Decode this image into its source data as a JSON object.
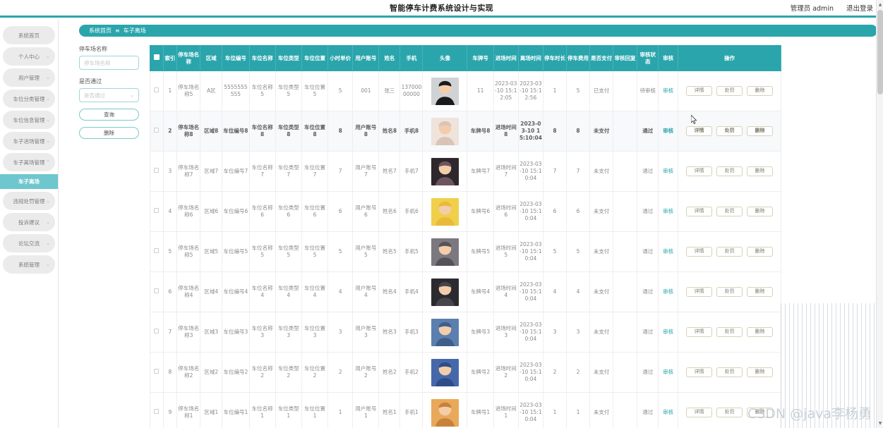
{
  "header": {
    "title": "智能停车计费系统设计与实现",
    "admin_label": "管理员 admin",
    "logout_label": "退出登录"
  },
  "sidebar": {
    "items": [
      {
        "label": "系统首页",
        "caret": "",
        "active": false
      },
      {
        "label": "个人中心",
        "caret": "⌄",
        "active": false
      },
      {
        "label": "用户管理",
        "caret": "⌄",
        "active": false
      },
      {
        "label": "车位分类管理",
        "caret": "⌄",
        "active": false
      },
      {
        "label": "车位信息管理",
        "caret": "⌄",
        "active": false
      },
      {
        "label": "车子进场管理",
        "caret": "⌄",
        "active": false
      },
      {
        "label": "车子离场管理",
        "caret": "⌃",
        "active": false
      },
      {
        "label": "车子离场",
        "caret": "",
        "active": true
      },
      {
        "label": "违规处罚管理",
        "caret": "⌄",
        "active": false
      },
      {
        "label": "投诉建议",
        "caret": "⌄",
        "active": false
      },
      {
        "label": "论坛交流",
        "caret": "⌄",
        "active": false
      },
      {
        "label": "系统管理",
        "caret": "⌄",
        "active": false
      }
    ]
  },
  "breadcrumb": {
    "home": "系统首页",
    "separator": "≡",
    "current": "车子离场"
  },
  "search": {
    "name_label": "停车场名称",
    "name_placeholder": "停车场名称",
    "name_value": "",
    "pass_label": "是否通过",
    "pass_placeholder": "是否通过",
    "pass_value": "",
    "chevron": "⌄",
    "query_button": "查询",
    "delete_button": "删除"
  },
  "table": {
    "headers": [
      "",
      "索引",
      "停车场名称",
      "区域",
      "车位编号",
      "车位名称",
      "车位类型",
      "车位位置",
      "小时单价",
      "用户账号",
      "姓名",
      "手机",
      "头像",
      "车牌号",
      "进场时间",
      "离场时间",
      "停车时长",
      "停车费用",
      "是否支付",
      "审核回复",
      "审核状态",
      "审核",
      "操作"
    ],
    "audit_link": "审核",
    "actions": [
      "详情",
      "处罚",
      "删除"
    ],
    "rows": [
      {
        "index": "1",
        "lot": "停车场名称5",
        "area": "A区",
        "spot_no": "5555555555",
        "spot_name": "车位名称5",
        "spot_type": "车位类型5",
        "spot_pos": "车位位置5",
        "hour_price": "5",
        "account": "001",
        "name": "张三",
        "phone": "13700000000",
        "avatar_color": "#e8d9cd",
        "avatar_kind": "man-suit",
        "plate": "11",
        "in_time": "2023-03-10 15:12:05",
        "out_time": "2023-03-10 15:12:56",
        "duration": "1",
        "fee": "5",
        "paid": "已支付",
        "reply": "",
        "status": "待审核",
        "highlight": false
      },
      {
        "index": "2",
        "lot": "停车场名称8",
        "area": "区域8",
        "spot_no": "车位编号8",
        "spot_name": "车位名称8",
        "spot_type": "车位类型8",
        "spot_pos": "车位位置8",
        "hour_price": "8",
        "account": "用户账号8",
        "name": "姓名8",
        "phone": "手机8",
        "avatar_color": "#f0dcd4",
        "avatar_kind": "woman-dog",
        "plate": "车牌号8",
        "in_time": "进场时间8",
        "out_time": "2023-03-10 15:10:04",
        "duration": "8",
        "fee": "8",
        "paid": "未支付",
        "reply": "",
        "status": "通过",
        "highlight": true
      },
      {
        "index": "3",
        "lot": "停车场名称7",
        "area": "区域7",
        "spot_no": "车位编号7",
        "spot_name": "车位名称7",
        "spot_type": "车位类型7",
        "spot_pos": "车位位置7",
        "hour_price": "7",
        "account": "用户账号7",
        "name": "姓名7",
        "phone": "手机7",
        "avatar_color": "#3a3338",
        "avatar_kind": "man-dark",
        "plate": "车牌号7",
        "in_time": "进场时间7",
        "out_time": "2023-03-10 15:10:04",
        "duration": "7",
        "fee": "7",
        "paid": "未支付",
        "reply": "",
        "status": "通过",
        "highlight": false
      },
      {
        "index": "4",
        "lot": "停车场名称6",
        "area": "区域6",
        "spot_no": "车位编号6",
        "spot_name": "车位名称6",
        "spot_type": "车位类型6",
        "spot_pos": "车位位置6",
        "hour_price": "6",
        "account": "用户账号6",
        "name": "姓名6",
        "phone": "手机6",
        "avatar_color": "#e9c84a",
        "avatar_kind": "man-yellow",
        "plate": "车牌号6",
        "in_time": "进场时间6",
        "out_time": "2023-03-10 15:10:04",
        "duration": "6",
        "fee": "6",
        "paid": "未支付",
        "reply": "",
        "status": "通过",
        "highlight": false
      },
      {
        "index": "5",
        "lot": "停车场名称5",
        "area": "区域5",
        "spot_no": "车位编号5",
        "spot_name": "车位名称5",
        "spot_type": "车位类型5",
        "spot_pos": "车位位置5",
        "hour_price": "5",
        "account": "用户账号5",
        "name": "姓名5",
        "phone": "手机5",
        "avatar_color": "#6d6a72",
        "avatar_kind": "man-grey",
        "plate": "车牌号5",
        "in_time": "进场时间5",
        "out_time": "2023-03-10 15:10:04",
        "duration": "5",
        "fee": "5",
        "paid": "未支付",
        "reply": "",
        "status": "通过",
        "highlight": false
      },
      {
        "index": "6",
        "lot": "停车场名称4",
        "area": "区域4",
        "spot_no": "车位编号4",
        "spot_name": "车位名称4",
        "spot_type": "车位类型4",
        "spot_pos": "车位位置4",
        "hour_price": "4",
        "account": "用户账号4",
        "name": "姓名4",
        "phone": "手机4",
        "avatar_color": "#2b2b2f",
        "avatar_kind": "man-black",
        "plate": "车牌号4",
        "in_time": "进场时间4",
        "out_time": "2023-03-10 15:10:04",
        "duration": "4",
        "fee": "4",
        "paid": "未支付",
        "reply": "",
        "status": "通过",
        "highlight": false
      },
      {
        "index": "7",
        "lot": "停车场名称3",
        "area": "区域3",
        "spot_no": "车位编号3",
        "spot_name": "车位名称3",
        "spot_type": "车位类型3",
        "spot_pos": "车位位置3",
        "hour_price": "3",
        "account": "用户账号3",
        "name": "姓名3",
        "phone": "手机3",
        "avatar_color": "#4f6f9a",
        "avatar_kind": "man-cap",
        "plate": "车牌号3",
        "in_time": "进场时间3",
        "out_time": "2023-03-10 15:10:04",
        "duration": "3",
        "fee": "3",
        "paid": "未支付",
        "reply": "",
        "status": "通过",
        "highlight": false
      },
      {
        "index": "8",
        "lot": "停车场名称2",
        "area": "区域2",
        "spot_no": "车位编号2",
        "spot_name": "车位名称2",
        "spot_type": "车位类型2",
        "spot_pos": "车位位置2",
        "hour_price": "2",
        "account": "用户账号2",
        "name": "姓名2",
        "phone": "手机2",
        "avatar_color": "#3b5fa0",
        "avatar_kind": "man-blue",
        "plate": "车牌号2",
        "in_time": "进场时间2",
        "out_time": "2023-03-10 15:10:04",
        "duration": "2",
        "fee": "2",
        "paid": "未支付",
        "reply": "",
        "status": "通过",
        "highlight": false
      },
      {
        "index": "9",
        "lot": "停车场名称1",
        "area": "区域1",
        "spot_no": "车位编号1",
        "spot_name": "车位名称1",
        "spot_type": "车位类型1",
        "spot_pos": "车位位置1",
        "hour_price": "1",
        "account": "用户账号1",
        "name": "姓名1",
        "phone": "手机1",
        "avatar_color": "#d88a3c",
        "avatar_kind": "anime-girl",
        "plate": "车牌号1",
        "in_time": "进场时间1",
        "out_time": "2023-03-10 15:10:04",
        "duration": "1",
        "fee": "1",
        "paid": "未支付",
        "reply": "",
        "status": "通过",
        "highlight": false
      }
    ]
  },
  "watermark": "CSDN @java李杨勇",
  "colors": {
    "accent": "#2aa5ac",
    "active_menu": "#6ec6ce",
    "menu_bg": "#ebebeb",
    "row_alt": "#f7f9fb"
  }
}
